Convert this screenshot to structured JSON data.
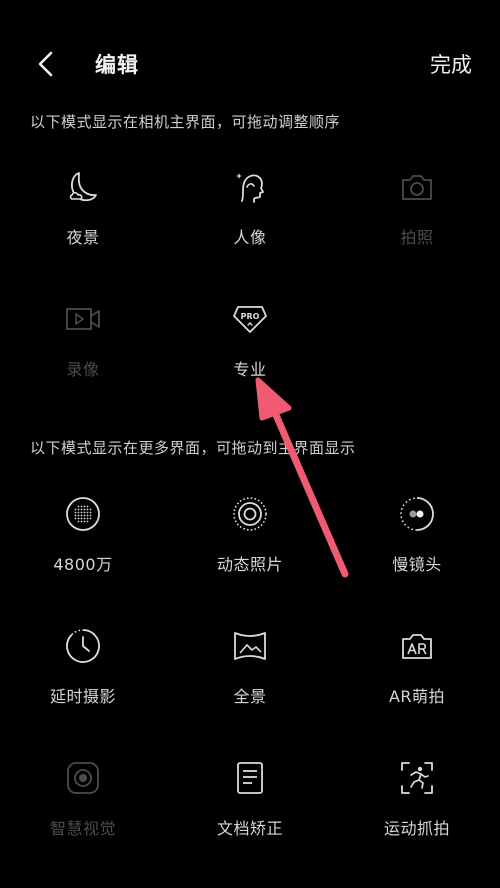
{
  "header": {
    "title": "编辑",
    "done_label": "完成"
  },
  "section_main": {
    "label": "以下模式显示在相机主界面，可拖动调整顺序",
    "modes": [
      {
        "label": "夜景",
        "icon": "moon-icon",
        "enabled": true
      },
      {
        "label": "人像",
        "icon": "portrait-icon",
        "enabled": true
      },
      {
        "label": "拍照",
        "icon": "camera-icon",
        "enabled": false
      },
      {
        "label": "录像",
        "icon": "video-icon",
        "enabled": false
      },
      {
        "label": "专业",
        "icon": "pro-icon",
        "enabled": true
      }
    ]
  },
  "section_more": {
    "label": "以下模式显示在更多界面，可拖动到主界面显示",
    "modes": [
      {
        "label": "4800万",
        "icon": "high-resolution-icon",
        "enabled": true
      },
      {
        "label": "动态照片",
        "icon": "live-photo-icon",
        "enabled": true
      },
      {
        "label": "慢镜头",
        "icon": "slow-motion-icon",
        "enabled": true
      },
      {
        "label": "延时摄影",
        "icon": "time-lapse-icon",
        "enabled": true
      },
      {
        "label": "全景",
        "icon": "panorama-icon",
        "enabled": true
      },
      {
        "label": "AR萌拍",
        "icon": "ar-icon",
        "enabled": true
      },
      {
        "label": "智慧视觉",
        "icon": "smart-vision-icon",
        "enabled": false
      },
      {
        "label": "文档矫正",
        "icon": "document-icon",
        "enabled": true
      },
      {
        "label": "运动抓拍",
        "icon": "motion-capture-icon",
        "enabled": true
      }
    ]
  },
  "colors": {
    "background": "#000000",
    "text": "#d6d6d6",
    "disabled": "#4c4c4c",
    "arrow": "#f05a72"
  }
}
